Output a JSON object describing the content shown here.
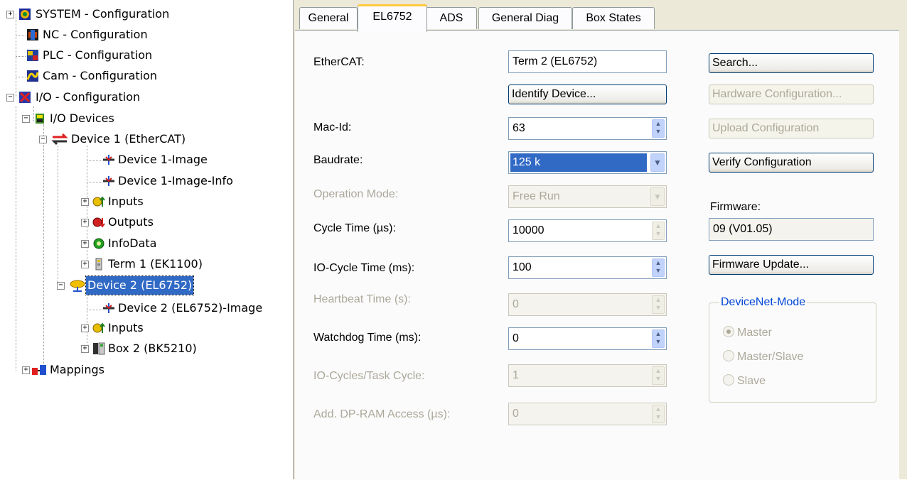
{
  "tree": {
    "items": [
      {
        "label": "SYSTEM - Configuration",
        "icon": "system-config-icon"
      },
      {
        "label": "NC - Configuration",
        "icon": "nc-config-icon"
      },
      {
        "label": "PLC - Configuration",
        "icon": "plc-config-icon"
      },
      {
        "label": "Cam - Configuration",
        "icon": "cam-config-icon"
      },
      {
        "label": "I/O - Configuration",
        "icon": "io-config-icon"
      },
      {
        "label": "I/O Devices",
        "icon": "io-devices-icon"
      },
      {
        "label": "Device 1 (EtherCAT)",
        "icon": "ethercat-device-icon"
      },
      {
        "label": "Device 1-Image",
        "icon": "image-icon"
      },
      {
        "label": "Device 1-Image-Info",
        "icon": "image-icon"
      },
      {
        "label": "Inputs",
        "icon": "inputs-icon"
      },
      {
        "label": "Outputs",
        "icon": "outputs-icon"
      },
      {
        "label": "InfoData",
        "icon": "infodata-icon"
      },
      {
        "label": "Term 1 (EK1100)",
        "icon": "terminal-icon"
      },
      {
        "label": "Device 2 (EL6752)",
        "icon": "devicenet-device-icon"
      },
      {
        "label": "Device 2 (EL6752)-Image",
        "icon": "image-icon"
      },
      {
        "label": "Inputs",
        "icon": "inputs-icon"
      },
      {
        "label": "Box 2 (BK5210)",
        "icon": "box-icon"
      },
      {
        "label": "Mappings",
        "icon": "mappings-icon"
      }
    ],
    "expanders": {
      "plus": "+",
      "minus": "−"
    },
    "selected_label": "Device 2 (EL6752)"
  },
  "tabs": [
    "General",
    "EL6752",
    "ADS",
    "General Diag",
    "Box States"
  ],
  "active_tab": "EL6752",
  "form": {
    "ethercat_label": "EtherCAT:",
    "ethercat_value": "Term 2 (EL6752)",
    "identify_button": "Identify Device...",
    "macid_label": "Mac-Id:",
    "macid_value": "63",
    "baudrate_label": "Baudrate:",
    "baudrate_value": "125 k",
    "opmode_label": "Operation Mode:",
    "opmode_value": "Free Run",
    "cycle_label": "Cycle Time (µs):",
    "cycle_value": "10000",
    "iocycle_label": "IO-Cycle Time (ms):",
    "iocycle_value": "100",
    "heartbeat_label": "Heartbeat Time (s):",
    "heartbeat_value": "0",
    "watchdog_label": "Watchdog Time (ms):",
    "watchdog_value": "0",
    "iocycles_label": "IO-Cycles/Task Cycle:",
    "iocycles_value": "1",
    "dpram_label": "Add. DP-RAM Access (µs):",
    "dpram_value": "0"
  },
  "right": {
    "search_button": "Search...",
    "hwconfig_button": "Hardware Configuration...",
    "upload_button": "Upload Configuration",
    "verify_button": "Verify Configuration",
    "firmware_label": "Firmware:",
    "firmware_value": "09 (V01.05)",
    "firmware_update_button": "Firmware Update...",
    "devicenet_legend": "DeviceNet-Mode",
    "radios": [
      "Master",
      "Master/Slave",
      "Slave"
    ],
    "selected_radio": "Master"
  },
  "colors": {
    "selection": "#316ac5",
    "panel_bg": "#ece9d8",
    "legend": "#0046d5",
    "tab_highlight": "#ffc83c"
  }
}
